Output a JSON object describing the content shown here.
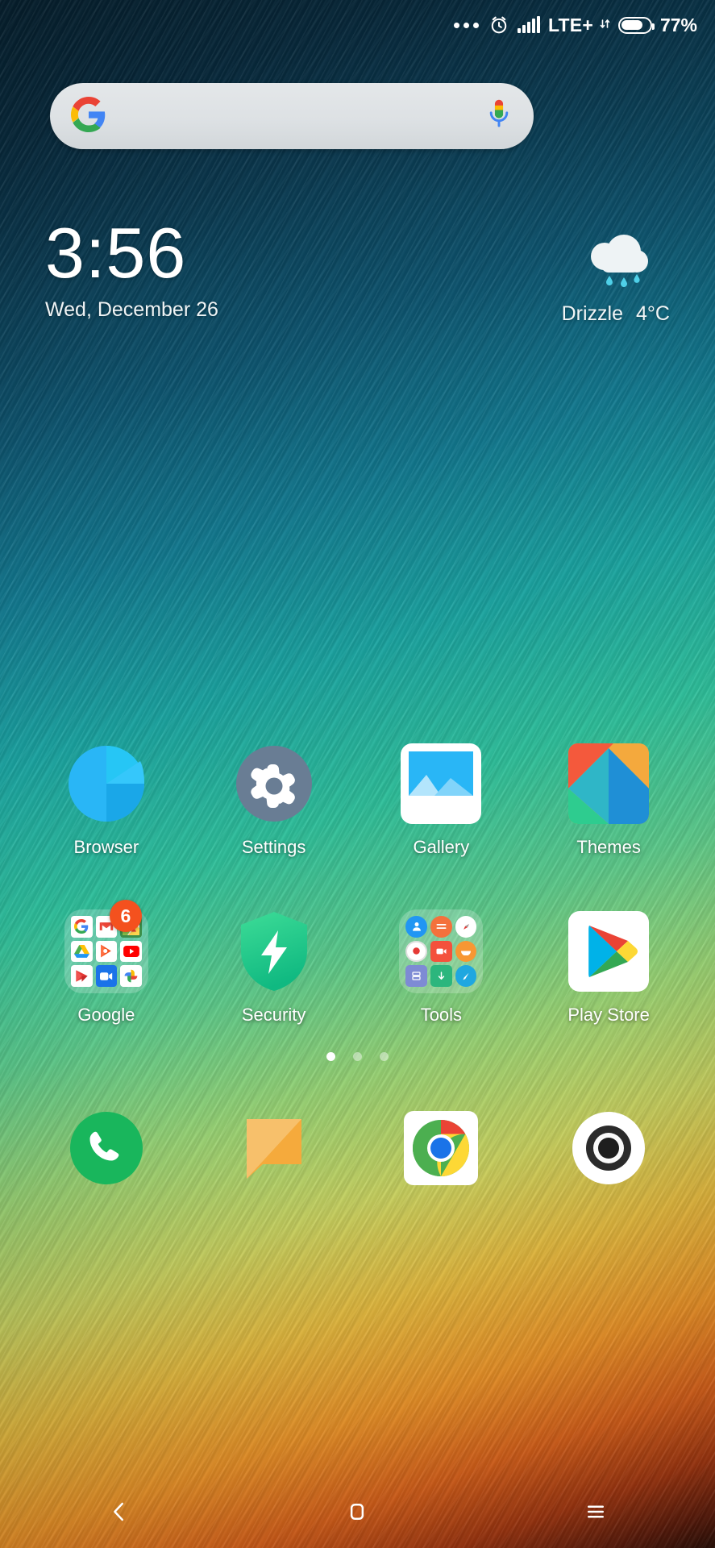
{
  "status_bar": {
    "notification_dots": "•••",
    "alarm_icon": "alarm-clock-icon",
    "signal_icon": "cellular-signal-icon",
    "network_label": "LTE+",
    "data_arrows": "⇅",
    "battery_icon": "battery-icon",
    "battery_percent": "77%"
  },
  "search": {
    "google_logo": "google-g-logo",
    "mic_icon": "microphone-icon",
    "placeholder": "",
    "value": ""
  },
  "clock_widget": {
    "time": "3:56",
    "date": "Wed, December 26",
    "weather_icon": "rain-cloud-icon",
    "weather_condition": "Drizzle",
    "temperature": "4°C"
  },
  "app_rows": [
    {
      "apps": [
        {
          "label": "Browser",
          "icon": "browser-icon"
        },
        {
          "label": "Settings",
          "icon": "settings-gear-icon"
        },
        {
          "label": "Gallery",
          "icon": "gallery-icon"
        },
        {
          "label": "Themes",
          "icon": "themes-icon"
        }
      ]
    },
    {
      "apps": [
        {
          "label": "Google",
          "icon": "google-folder-icon",
          "badge": "6",
          "folder_items": [
            "Google Search",
            "Gmail",
            "Maps",
            "Drive",
            "Play Music",
            "YouTube",
            "Play Movies",
            "Duo",
            "Photos"
          ]
        },
        {
          "label": "Security",
          "icon": "security-shield-icon"
        },
        {
          "label": "Tools",
          "icon": "tools-folder-icon",
          "folder_items": [
            "Contacts",
            "Calculator",
            "Compass",
            "Recorder",
            "Video",
            "Weather",
            "Scanner",
            "Downloads",
            "Notes"
          ]
        },
        {
          "label": "Play Store",
          "icon": "play-store-icon"
        }
      ]
    }
  ],
  "page_indicator": {
    "total": 3,
    "active": 1
  },
  "dock": {
    "apps": [
      {
        "label": "Phone",
        "icon": "phone-icon"
      },
      {
        "label": "Messaging",
        "icon": "messaging-icon"
      },
      {
        "label": "Chrome",
        "icon": "chrome-icon"
      },
      {
        "label": "Camera",
        "icon": "camera-icon"
      }
    ]
  },
  "nav_bar": {
    "back": "back-chevron-icon",
    "home": "home-square-icon",
    "recents": "menu-hamburger-icon"
  },
  "colors": {
    "accent_orange": "#f4511e",
    "security_green": "#21c87a",
    "phone_green": "#19b65c",
    "message_orange": "#f7bc5e"
  }
}
